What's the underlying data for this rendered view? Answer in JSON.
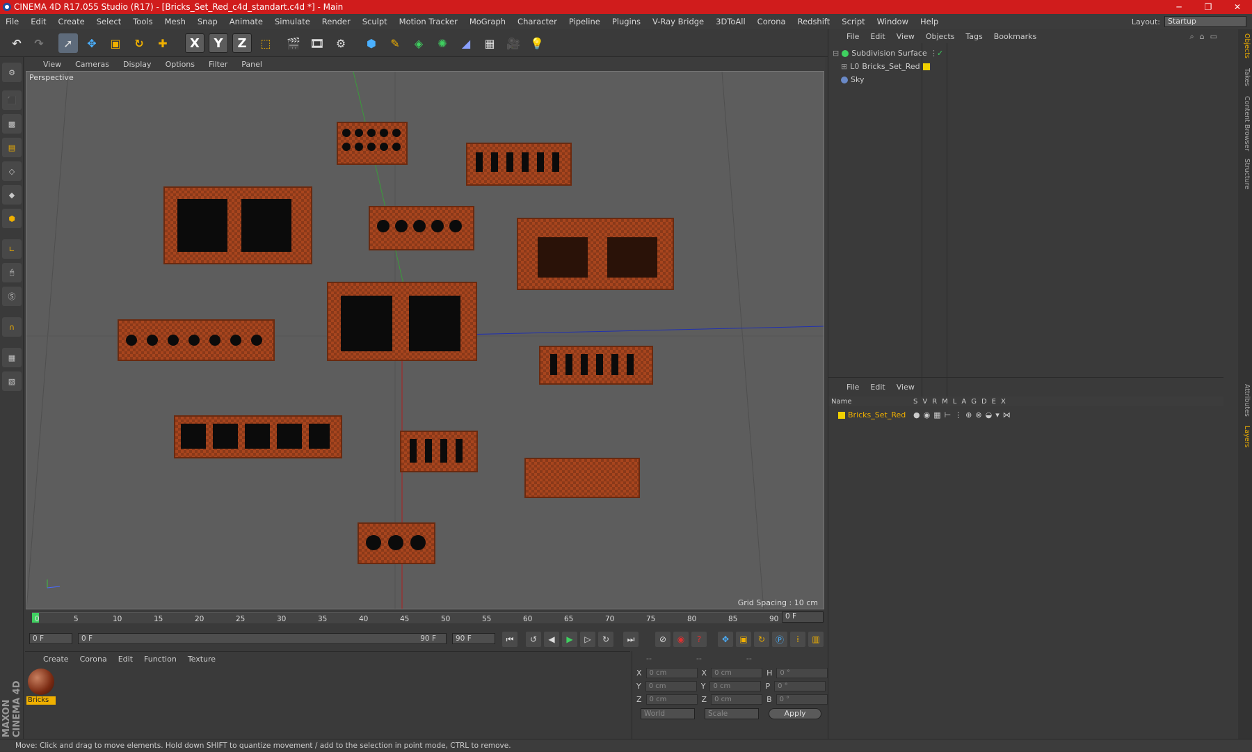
{
  "window": {
    "title": "CINEMA 4D R17.055 Studio (R17) - [Bricks_Set_Red_c4d_standart.c4d *] - Main",
    "minimize": "─",
    "maximize": "❐",
    "close": "✕"
  },
  "menubar": [
    "File",
    "Edit",
    "Create",
    "Select",
    "Tools",
    "Mesh",
    "Snap",
    "Animate",
    "Simulate",
    "Render",
    "Sculpt",
    "Motion Tracker",
    "MoGraph",
    "Character",
    "Pipeline",
    "Plugins",
    "V-Ray Bridge",
    "3DToAll",
    "Corona",
    "Redshift",
    "Script",
    "Window",
    "Help"
  ],
  "layout": {
    "label": "Layout:",
    "value": "Startup"
  },
  "toolbar": {
    "x_axis": "X",
    "y_axis": "Y",
    "z_axis": "Z"
  },
  "viewport": {
    "menu": [
      "View",
      "Cameras",
      "Display",
      "Options",
      "Filter",
      "Panel"
    ],
    "label": "Perspective",
    "grid_spacing": "Grid Spacing : 10 cm"
  },
  "timeline": {
    "ticks": [
      "0",
      "5",
      "10",
      "15",
      "20",
      "25",
      "30",
      "35",
      "40",
      "45",
      "50",
      "55",
      "60",
      "65",
      "70",
      "75",
      "80",
      "85",
      "90"
    ],
    "end_field": "0 F"
  },
  "transport": {
    "start": "0 F",
    "range_start": "0 F",
    "range_end": "90 F",
    "end": "90 F"
  },
  "materials": {
    "menu": [
      "Create",
      "Corona",
      "Edit",
      "Function",
      "Texture"
    ],
    "items": [
      {
        "name": "Bricks"
      }
    ]
  },
  "coords": {
    "header": [
      "--",
      "--",
      "--"
    ],
    "rows": [
      {
        "a": "X",
        "av": "0 cm",
        "b": "X",
        "bv": "0 cm",
        "c": "H",
        "cv": "0 °"
      },
      {
        "a": "Y",
        "av": "0 cm",
        "b": "Y",
        "bv": "0 cm",
        "c": "P",
        "cv": "0 °"
      },
      {
        "a": "Z",
        "av": "0 cm",
        "b": "Z",
        "bv": "0 cm",
        "c": "B",
        "cv": "0 °"
      }
    ],
    "world": "World",
    "scale": "Scale",
    "apply": "Apply"
  },
  "objects": {
    "menu": [
      "File",
      "Edit",
      "View",
      "Objects",
      "Tags",
      "Bookmarks"
    ],
    "items": [
      {
        "name": "Subdivision Surface"
      },
      {
        "name": "Bricks_Set_Red"
      },
      {
        "name": "Sky"
      }
    ]
  },
  "layers": {
    "menu": [
      "File",
      "Edit",
      "View"
    ],
    "header": "Name",
    "columns": [
      "S",
      "V",
      "R",
      "M",
      "L",
      "A",
      "G",
      "D",
      "E",
      "X"
    ],
    "items": [
      {
        "name": "Bricks_Set_Red",
        "color": "#f0d000"
      }
    ]
  },
  "sidetabs": [
    "Objects",
    "Takes",
    "Content Browser",
    "Structure",
    "Attributes",
    "Layers"
  ],
  "status": "Move: Click and drag to move elements. Hold down SHIFT to quantize movement / add to the selection in point mode, CTRL to remove.",
  "logo": "MAXON CINEMA 4D"
}
